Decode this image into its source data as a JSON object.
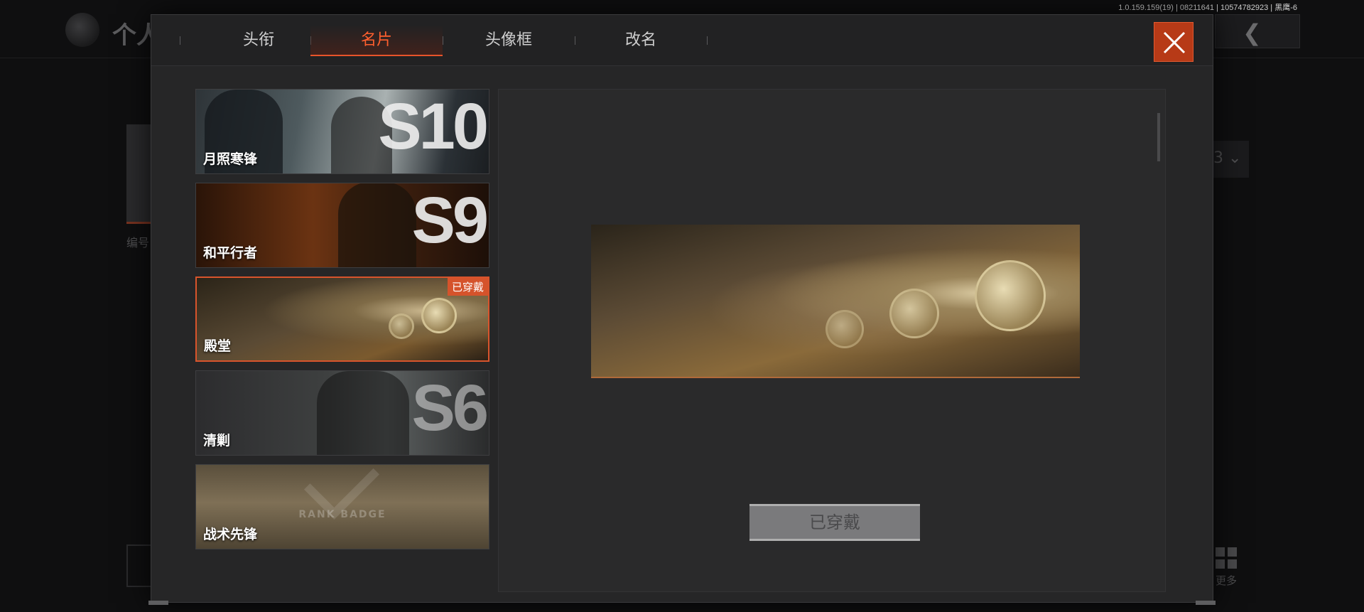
{
  "background": {
    "title": "个人",
    "id_label": "编号",
    "dropdown_value": "3",
    "more_label": "更多"
  },
  "version": "1.0.159.159(19) | 08211641 | 10574782923 | 黑鹰-6",
  "tabs": [
    {
      "label": "头衔",
      "active": false
    },
    {
      "label": "名片",
      "active": true
    },
    {
      "label": "头像框",
      "active": false
    },
    {
      "label": "改名",
      "active": false
    }
  ],
  "cards": [
    {
      "label": "月照寒锋",
      "season": "S10",
      "equipped": false
    },
    {
      "label": "和平行者",
      "season": "S9",
      "equipped": false
    },
    {
      "label": "殿堂",
      "season": "",
      "equipped": true
    },
    {
      "label": "清剿",
      "season": "S6",
      "equipped": false
    },
    {
      "label": "战术先锋",
      "season": "",
      "equipped": false
    }
  ],
  "equipped_badge": "已穿戴",
  "preview": {
    "button_label": "已穿戴"
  },
  "rank_badge_text": "RANK BADGE",
  "colors": {
    "accent": "#e8542a",
    "close_bg": "#b73a17",
    "modal_bg": "#262627"
  }
}
